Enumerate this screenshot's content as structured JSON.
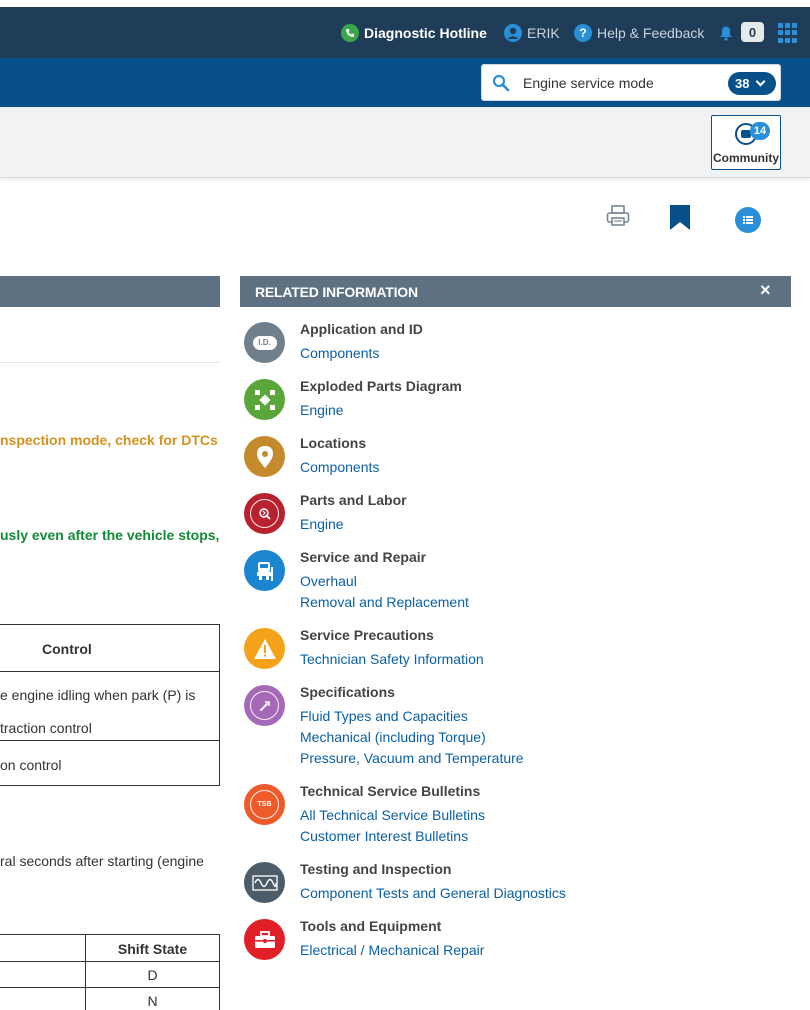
{
  "topbar": {
    "hotline_label": "Diagnostic Hotline",
    "user_name": "ERIK",
    "help_label": "Help & Feedback",
    "notification_count": "0"
  },
  "search": {
    "value": "Engine service mode",
    "result_count": "38"
  },
  "community": {
    "label": "Community",
    "badge": "14"
  },
  "article": {
    "orange_note": "nspection mode, check for DTCs",
    "green_note": "usly even after the vehicle stops,",
    "control_table": {
      "header": "Control",
      "row1_line1": "e engine idling when park (P) is",
      "row1_line2": "traction control",
      "row2": "on control"
    },
    "paragraph": "ral seconds after starting (engine",
    "shift_table": {
      "header": "Shift State",
      "rows": [
        "D",
        "N"
      ]
    }
  },
  "related": {
    "title": "RELATED INFORMATION",
    "close": "×",
    "items": [
      {
        "title": "Application and ID",
        "icon": "id-icon",
        "badge_text": "I.D.",
        "links": [
          "Components"
        ]
      },
      {
        "title": "Exploded Parts Diagram",
        "icon": "exploded-parts-icon",
        "links": [
          "Engine"
        ]
      },
      {
        "title": "Locations",
        "icon": "location-pin-icon",
        "links": [
          "Components"
        ]
      },
      {
        "title": "Parts and Labor",
        "icon": "parts-labor-icon",
        "links": [
          "Engine"
        ]
      },
      {
        "title": "Service and Repair",
        "icon": "service-repair-icon",
        "links": [
          "Overhaul",
          "Removal and Replacement"
        ]
      },
      {
        "title": "Service Precautions",
        "icon": "warning-icon",
        "links": [
          "Technician Safety Information"
        ]
      },
      {
        "title": "Specifications",
        "icon": "specifications-icon",
        "links": [
          "Fluid Types and Capacities",
          "Mechanical (including Torque)",
          "Pressure, Vacuum and Temperature"
        ]
      },
      {
        "title": "Technical Service Bulletins",
        "icon": "tsb-icon",
        "badge_text": "TSB",
        "links": [
          "All Technical Service Bulletins",
          "Customer Interest Bulletins"
        ]
      },
      {
        "title": "Testing and Inspection",
        "icon": "waveform-icon",
        "links": [
          "Component Tests and General Diagnostics"
        ]
      },
      {
        "title": "Tools and Equipment",
        "icon": "toolbox-icon",
        "links": [
          "Electrical / Mechanical Repair"
        ]
      }
    ]
  },
  "colors": {
    "topbar": "#1f3d59",
    "bluebar": "#07508a",
    "accent": "#2a8fd6",
    "panel_header": "#5e7182",
    "link": "#0b5fa5",
    "orange_text": "#d4931e",
    "green_text": "#138a38"
  }
}
